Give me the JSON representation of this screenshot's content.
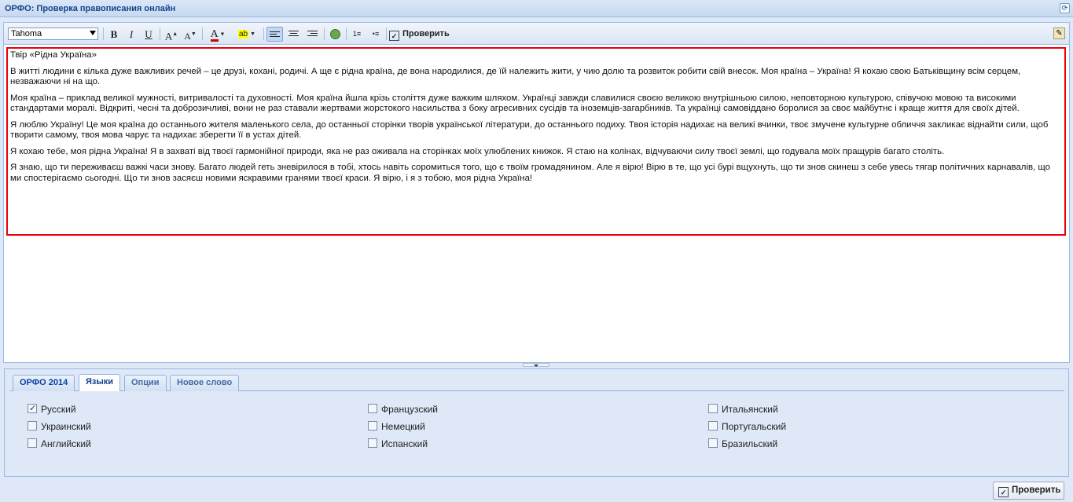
{
  "window": {
    "title": "ОРФО: Проверка правописания онлайн",
    "refresh_icon": "refresh-icon"
  },
  "toolbar": {
    "font": "Tahoma",
    "check_label": "Проверить",
    "icons": [
      "bold-icon",
      "italic-icon",
      "underline-icon",
      "grow-font-icon",
      "shrink-font-icon",
      "font-color-icon",
      "highlight-icon",
      "align-left-icon",
      "align-center-icon",
      "align-right-icon",
      "globe-link-icon",
      "ordered-list-icon",
      "unordered-list-icon",
      "spellcheck-icon",
      "edit-source-icon"
    ],
    "font_color": "#d20000",
    "highlight_color": "#ffff00"
  },
  "document": {
    "paragraphs": [
      "Твір «Рідна Україна»",
      "В житті людини є кілька дуже важливих речей – це друзі, кохані, родичі. А ще є рідна країна, де вона народилися, де їй належить жити, у чию долю та розвиток робити свій внесок. Моя країна – Україна! Я кохаю свою Батьківщину всім серцем, незважаючи ні на що.",
      "Моя країна – приклад великої мужності, витривалості та духовності. Моя країна йшла крізь століття дуже важким шляхом. Українці завжди славилися своєю великою внутрішньою силою, неповторною культурою, співучою мовою та високими стандартами моралі. Відкриті, чесні та доброзичливі, вони не раз ставали жертвами жорстокого насильства з боку агресивних сусідів та іноземців-загарбників. Та українці самовіддано боролися за своє майбутнє і краще життя для своїх дітей.",
      "Я люблю Україну! Це моя країна до останнього жителя маленького села, до останньої сторінки творів української літератури, до останнього подиху. Твоя історія надихає на великі вчинки, твоє змучене культурне обличчя закликає віднайти сили, щоб творити самому, твоя мова чарує та надихає зберегти її в устах дітей.",
      "Я кохаю тебе, моя рідна Україна! Я в захваті від твоєї гармонійної природи, яка не раз оживала на сторінках моїх улюблених книжок. Я стаю на колінах, відчуваючи силу твоєї землі, що годувала моїх пращурів багато століть.",
      "Я знаю, що ти переживаєш важкі часи знову. Багато людей геть зневірилося в тобі, хтось навіть соромиться того, що є твоїм громадянином. Але я вірю! Вірю в те, що усі бурі вщухнуть, що ти знов скинеш з себе увесь тягар політичних карнавалів, що ми спостерігаємо сьогодні. Що ти знов засяєш новими яскравими гранями твоєї краси. Я вірю, і я з тобою, моя рідна Україна!"
    ],
    "highlight_border_color": "#e8000a"
  },
  "tabs": [
    {
      "label": "ОРФО 2014",
      "active": false
    },
    {
      "label": "Языки",
      "active": true
    },
    {
      "label": "Опции",
      "active": false
    },
    {
      "label": "Новое слово",
      "active": false
    }
  ],
  "languages": {
    "columns": [
      [
        {
          "label": "Русский",
          "checked": true
        },
        {
          "label": "Украинский",
          "checked": false
        },
        {
          "label": "Английский",
          "checked": false
        }
      ],
      [
        {
          "label": "Французский",
          "checked": false
        },
        {
          "label": "Немецкий",
          "checked": false
        },
        {
          "label": "Испанский",
          "checked": false
        }
      ],
      [
        {
          "label": "Итальянский",
          "checked": false
        },
        {
          "label": "Португальский",
          "checked": false
        },
        {
          "label": "Бразильский",
          "checked": false
        }
      ]
    ]
  },
  "footer": {
    "check_label": "Проверить"
  }
}
